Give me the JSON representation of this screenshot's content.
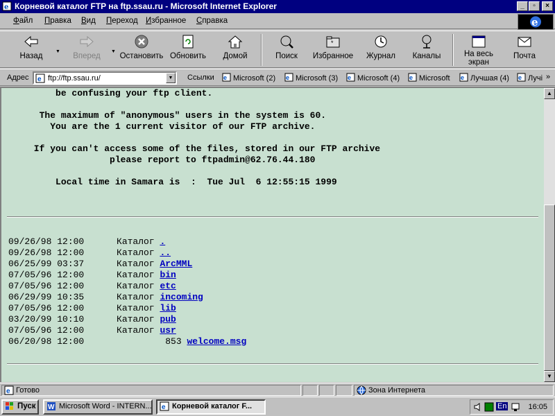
{
  "window": {
    "title": "Корневой каталог FTP на ftp.ssau.ru - Microsoft Internet Explorer",
    "controls": {
      "minimize": "_",
      "maximize": "▫",
      "close": "×"
    }
  },
  "menu": {
    "items": [
      {
        "label": "Файл",
        "key": "Ф",
        "rest": "айл"
      },
      {
        "label": "Правка",
        "key": "П",
        "rest": "равка"
      },
      {
        "label": "Вид",
        "key": "В",
        "rest": "ид"
      },
      {
        "label": "Переход",
        "key": "П",
        "rest": "ереход"
      },
      {
        "label": "Избранное",
        "key": "И",
        "rest": "збранное"
      },
      {
        "label": "Справка",
        "key": "С",
        "rest": "правка"
      }
    ]
  },
  "toolbar": {
    "back": "Назад",
    "forward": "Вперед",
    "stop": "Остановить",
    "refresh": "Обновить",
    "home": "Домой",
    "search": "Поиск",
    "favorites": "Избранное",
    "history": "Журнал",
    "channels": "Каналы",
    "fullscreen_1": "На весь",
    "fullscreen_2": "экран",
    "mail": "Почта"
  },
  "address": {
    "label": "Адрес",
    "value": "ftp://ftp.ssau.ru/"
  },
  "links": {
    "label": "Ссылки",
    "items": [
      "Microsoft (2)",
      "Microsoft (3)",
      "Microsoft (4)",
      "Microsoft",
      "Лучшая (4)",
      "Лучі"
    ],
    "more": "»"
  },
  "content": {
    "message_lines": [
      "          be confusing your ftp client.",
      "",
      "       The maximum of \"anonymous\" users in the system is 60.",
      "         You are the 1 current visitor of our FTP archive.",
      "",
      "      If you can't access some of the files, stored in our FTP archive",
      "                    please report to ftpadmin@62.76.44.180",
      "",
      "          Local time in Samara is  :  Tue Jul  6 12:55:15 1999"
    ],
    "listing": [
      {
        "date": "09/26/98",
        "time": "12:00",
        "type": "Каталог",
        "size": "",
        "name": "."
      },
      {
        "date": "09/26/98",
        "time": "12:00",
        "type": "Каталог",
        "size": "",
        "name": ".."
      },
      {
        "date": "06/25/99",
        "time": "03:37",
        "type": "Каталог",
        "size": "",
        "name": "ArcMML"
      },
      {
        "date": "07/05/96",
        "time": "12:00",
        "type": "Каталог",
        "size": "",
        "name": "bin"
      },
      {
        "date": "07/05/96",
        "time": "12:00",
        "type": "Каталог",
        "size": "",
        "name": "etc"
      },
      {
        "date": "06/29/99",
        "time": "10:35",
        "type": "Каталог",
        "size": "",
        "name": "incoming"
      },
      {
        "date": "07/05/96",
        "time": "12:00",
        "type": "Каталог",
        "size": "",
        "name": "lib"
      },
      {
        "date": "03/20/99",
        "time": "10:10",
        "type": "Каталог",
        "size": "",
        "name": "pub"
      },
      {
        "date": "07/05/96",
        "time": "12:00",
        "type": "Каталог",
        "size": "",
        "name": "usr"
      },
      {
        "date": "06/20/98",
        "time": "12:00",
        "type": "",
        "size": "853",
        "name": "welcome.msg"
      }
    ]
  },
  "status": {
    "text": "Готово",
    "zone": "Зона Интернета"
  },
  "taskbar": {
    "start": "Пуск",
    "tasks": [
      "Microsoft Word - INTERN...",
      "Корневой каталог F..."
    ],
    "lang": "En",
    "clock": "16:05"
  },
  "colors": {
    "titlebar": "#000080",
    "content_bg": "#c8e0d0",
    "link": "#0000c0",
    "desktop": "#008080"
  }
}
